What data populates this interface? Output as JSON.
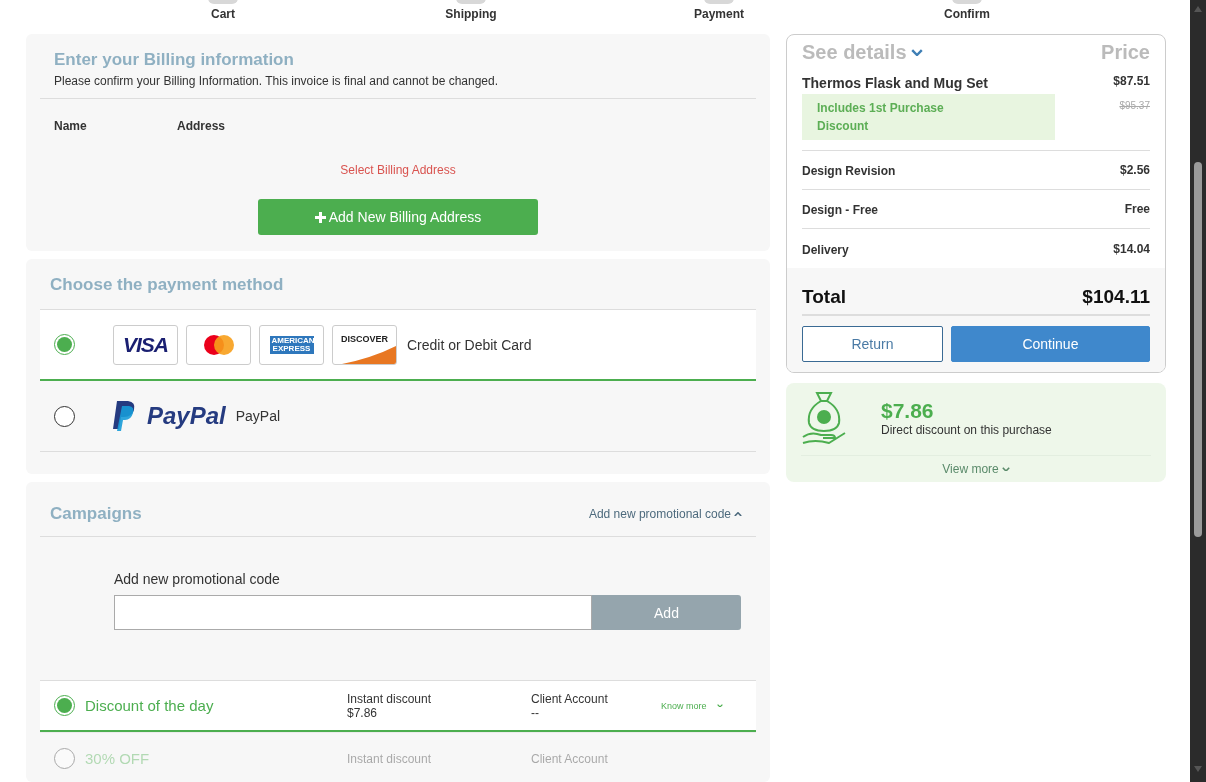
{
  "steps": [
    {
      "label": "Cart"
    },
    {
      "label": "Shipping"
    },
    {
      "label": "Payment"
    },
    {
      "label": "Confirm"
    }
  ],
  "billing": {
    "title": "Enter your Billing information",
    "subtitle": "Please confirm your Billing Information. This invoice is final and cannot be changed.",
    "columns": [
      "Name",
      "Address"
    ],
    "warning": "Select Billing Address",
    "button": "Add New Billing Address"
  },
  "payment": {
    "title": "Choose the payment method",
    "methods": [
      {
        "label": "Credit or Debit Card",
        "selected": true,
        "logos": [
          {
            "kind": "visa",
            "text": "VISA"
          },
          {
            "kind": "mastercard"
          },
          {
            "kind": "amex",
            "text": "AMERICAN EXPRESS"
          },
          {
            "kind": "discover",
            "text": "DISCOVER"
          }
        ]
      },
      {
        "label": "PayPal",
        "selected": false,
        "logos": [
          {
            "kind": "paypal",
            "text": "PayPal"
          }
        ]
      }
    ]
  },
  "campaigns": {
    "title": "Campaigns",
    "toggle": "Add new promotional code",
    "expanded": true,
    "promo_label": "Add new promotional code",
    "promo_button": "Add",
    "offers": [
      {
        "title": "Discount of the day",
        "selected": true,
        "discount_label": "Instant discount",
        "discount_value": "$7.86",
        "account_label": "Client Account",
        "account_value": "--",
        "link": "Know more"
      },
      {
        "title": "30% OFF",
        "selected": false,
        "discount_label": "Instant discount",
        "account_label": "Client Account"
      }
    ]
  },
  "summary": {
    "header": "See details",
    "price_header": "Price",
    "items": [
      {
        "kind": "product",
        "name": "Thermos Flask and Mug Set",
        "price": "$87.51",
        "note": "Includes 1st Purchase Discount",
        "old_price": "$95.37"
      },
      {
        "kind": "line",
        "name": "Design Revision",
        "price": "$2.56"
      },
      {
        "kind": "line",
        "name": "Design - Free",
        "price": "Free"
      },
      {
        "kind": "line",
        "name": "Delivery",
        "price": "$14.04"
      }
    ],
    "total_label": "Total",
    "total": "$104.11",
    "buttons": [
      {
        "kind": "secondary",
        "label": "Return"
      },
      {
        "kind": "primary",
        "label": "Continue"
      }
    ]
  },
  "savings": {
    "amount": "$7.86",
    "text": "Direct discount on this purchase",
    "link": "View more"
  }
}
